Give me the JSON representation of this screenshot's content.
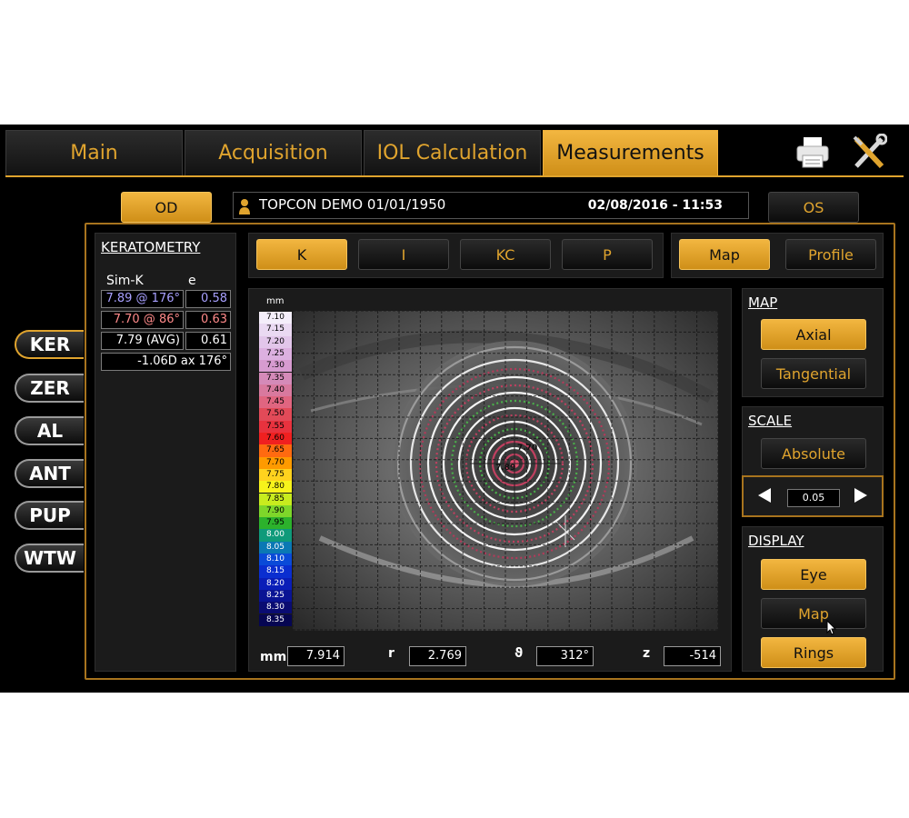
{
  "tabs": [
    {
      "label": "Main"
    },
    {
      "label": "Acquisition"
    },
    {
      "label": "IOL Calculation"
    },
    {
      "label": "Measurements"
    }
  ],
  "header": {
    "od_label": "OD",
    "os_label": "OS",
    "patient": "TOPCON DEMO 01/01/1950",
    "datetime": "02/08/2016 - 11:53"
  },
  "side_menu": [
    {
      "label": "KER"
    },
    {
      "label": "ZER"
    },
    {
      "label": "AL"
    },
    {
      "label": "ANT"
    },
    {
      "label": "PUP"
    },
    {
      "label": "WTW"
    }
  ],
  "keratometry": {
    "title": "KERATOMETRY",
    "col_simk": "Sim-K",
    "col_e": "e",
    "rows": [
      {
        "simk": "7.89 @ 176°",
        "e": "0.58",
        "color": "#a8a0ff"
      },
      {
        "simk": "7.70 @ 86°",
        "e": "0.63",
        "color": "#ff8a8a"
      },
      {
        "simk": "7.79 (AVG)",
        "e": "0.61",
        "color": "#ffffff"
      }
    ],
    "astig": "-1.06D ax 176°"
  },
  "mode_buttons": [
    {
      "label": "K"
    },
    {
      "label": "I"
    },
    {
      "label": "KC"
    },
    {
      "label": "P"
    }
  ],
  "view_buttons": [
    {
      "label": "Map"
    },
    {
      "label": "Profile"
    }
  ],
  "map_panel": {
    "title": "MAP",
    "axial": "Axial",
    "tangential": "Tangential"
  },
  "scale_panel": {
    "title": "SCALE",
    "absolute": "Absolute",
    "step": "0.05"
  },
  "display_panel": {
    "title": "DISPLAY",
    "eye": "Eye",
    "map": "Map",
    "rings": "Rings"
  },
  "legend": {
    "unit": "mm",
    "entries": [
      {
        "v": "7.10",
        "c": "#f4eefa"
      },
      {
        "v": "7.15",
        "c": "#ead9f2"
      },
      {
        "v": "7.20",
        "c": "#e2c6ea"
      },
      {
        "v": "7.25",
        "c": "#dcb0e0"
      },
      {
        "v": "7.30",
        "c": "#d79bd0"
      },
      {
        "v": "7.35",
        "c": "#d48ab8"
      },
      {
        "v": "7.40",
        "c": "#d8799e"
      },
      {
        "v": "7.45",
        "c": "#e06580"
      },
      {
        "v": "7.50",
        "c": "#e24a58"
      },
      {
        "v": "7.55",
        "c": "#e8323e"
      },
      {
        "v": "7.60",
        "c": "#f02020"
      },
      {
        "v": "7.65",
        "c": "#ff6a10"
      },
      {
        "v": "7.70",
        "c": "#ff9a00"
      },
      {
        "v": "7.75",
        "c": "#ffd21e"
      },
      {
        "v": "7.80",
        "c": "#f7f31b"
      },
      {
        "v": "7.85",
        "c": "#c8ec1e"
      },
      {
        "v": "7.90",
        "c": "#7ed62a"
      },
      {
        "v": "7.95",
        "c": "#2cb22c"
      },
      {
        "v": "8.00",
        "c": "#0f9a7a"
      },
      {
        "v": "8.05",
        "c": "#0a78b4"
      },
      {
        "v": "8.10",
        "c": "#0a4ad8"
      },
      {
        "v": "8.15",
        "c": "#0a2ed0"
      },
      {
        "v": "8.20",
        "c": "#0a1eb8"
      },
      {
        "v": "8.25",
        "c": "#0a1494"
      },
      {
        "v": "8.30",
        "c": "#0a0c72"
      },
      {
        "v": "8.35",
        "c": "#060652"
      }
    ]
  },
  "map_labels": {
    "k1": "7.70",
    "k2": "7.89"
  },
  "readouts": [
    {
      "label": "mm",
      "value": "7.914"
    },
    {
      "label": "r",
      "value": "2.769"
    },
    {
      "label": "ϑ",
      "value": "312°"
    },
    {
      "label": "z",
      "value": "-514"
    }
  ],
  "colors": {
    "accent": "#e0a42e",
    "panel": "#1b1b1b",
    "background": "#000000"
  }
}
